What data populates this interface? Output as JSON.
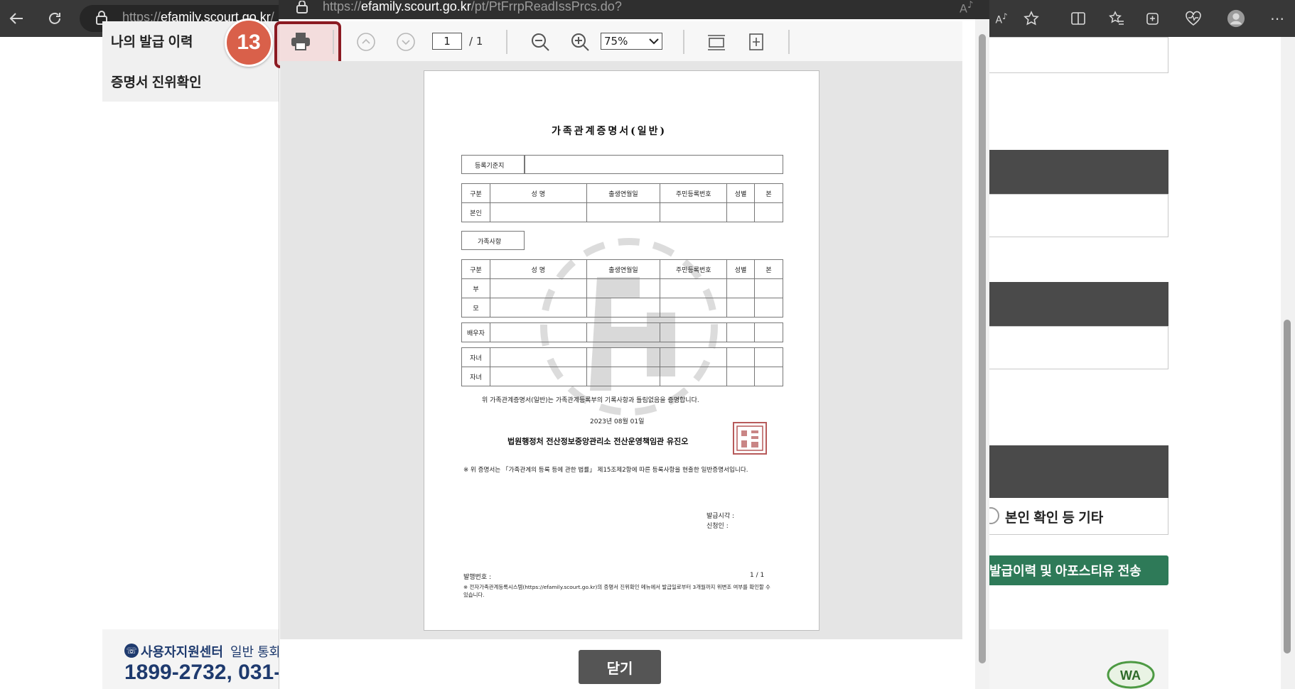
{
  "browser": {
    "url_prefix": "https://",
    "url_host": "efamily.scourt.go.kr",
    "url_path": "/"
  },
  "background": {
    "nav_items": [
      "나의 발급 이력",
      "증명서 진위확인"
    ],
    "radio_label": "본인 확인 등 기타",
    "green_button": "발급이력 및 아포스티유 전송",
    "footer": {
      "center_label": "사용자지원센터",
      "general_label": "일반 통화",
      "phone": "1899-2732, 031-"
    }
  },
  "popup": {
    "url_prefix": "https://",
    "url_host": "efamily.scourt.go.kr",
    "url_path": "/pt/PtFrrpReadIssPrcs.do?",
    "step_badge": "13",
    "page_current": "1",
    "page_total": "/ 1",
    "zoom": "75%",
    "close_label": "닫기"
  },
  "document": {
    "title": "가족관계증명서(일반)",
    "reg_label": "등록기준지",
    "headers": [
      "구분",
      "성 명",
      "출생연월일",
      "주민등록번호",
      "성별",
      "본"
    ],
    "self_label": "본인",
    "family_label": "가족사항",
    "rows": [
      "부",
      "모",
      "배우자",
      "자녀",
      "자녀"
    ],
    "statement": "위 가족관계증명서(일반)는 가족관계등록부의 기록사항과 틀림없음을 증명합니다.",
    "date": "2023년 08월 01일",
    "issuer": "법원행정처 전산정보중앙관리소 전산운영책임관 유진오",
    "notice": "※ 위 증명서는 「가족관계의 등록 등에 관한 법률」 제15조제2항에 따른 등록사항을 현출한 일반증명서입니다.",
    "issue_time": "발급시각 :",
    "applicant": "신청인 :",
    "doc_no": "발행번호 :",
    "page_num": "1 / 1",
    "footnote": "※ 전자가족관계등록시스템(https://efamily.scourt.go.kr)의 증명서 진위확인 메뉴에서 발급일로부터 3개월까지 위변조 여부를 확인할 수 있습니다."
  }
}
